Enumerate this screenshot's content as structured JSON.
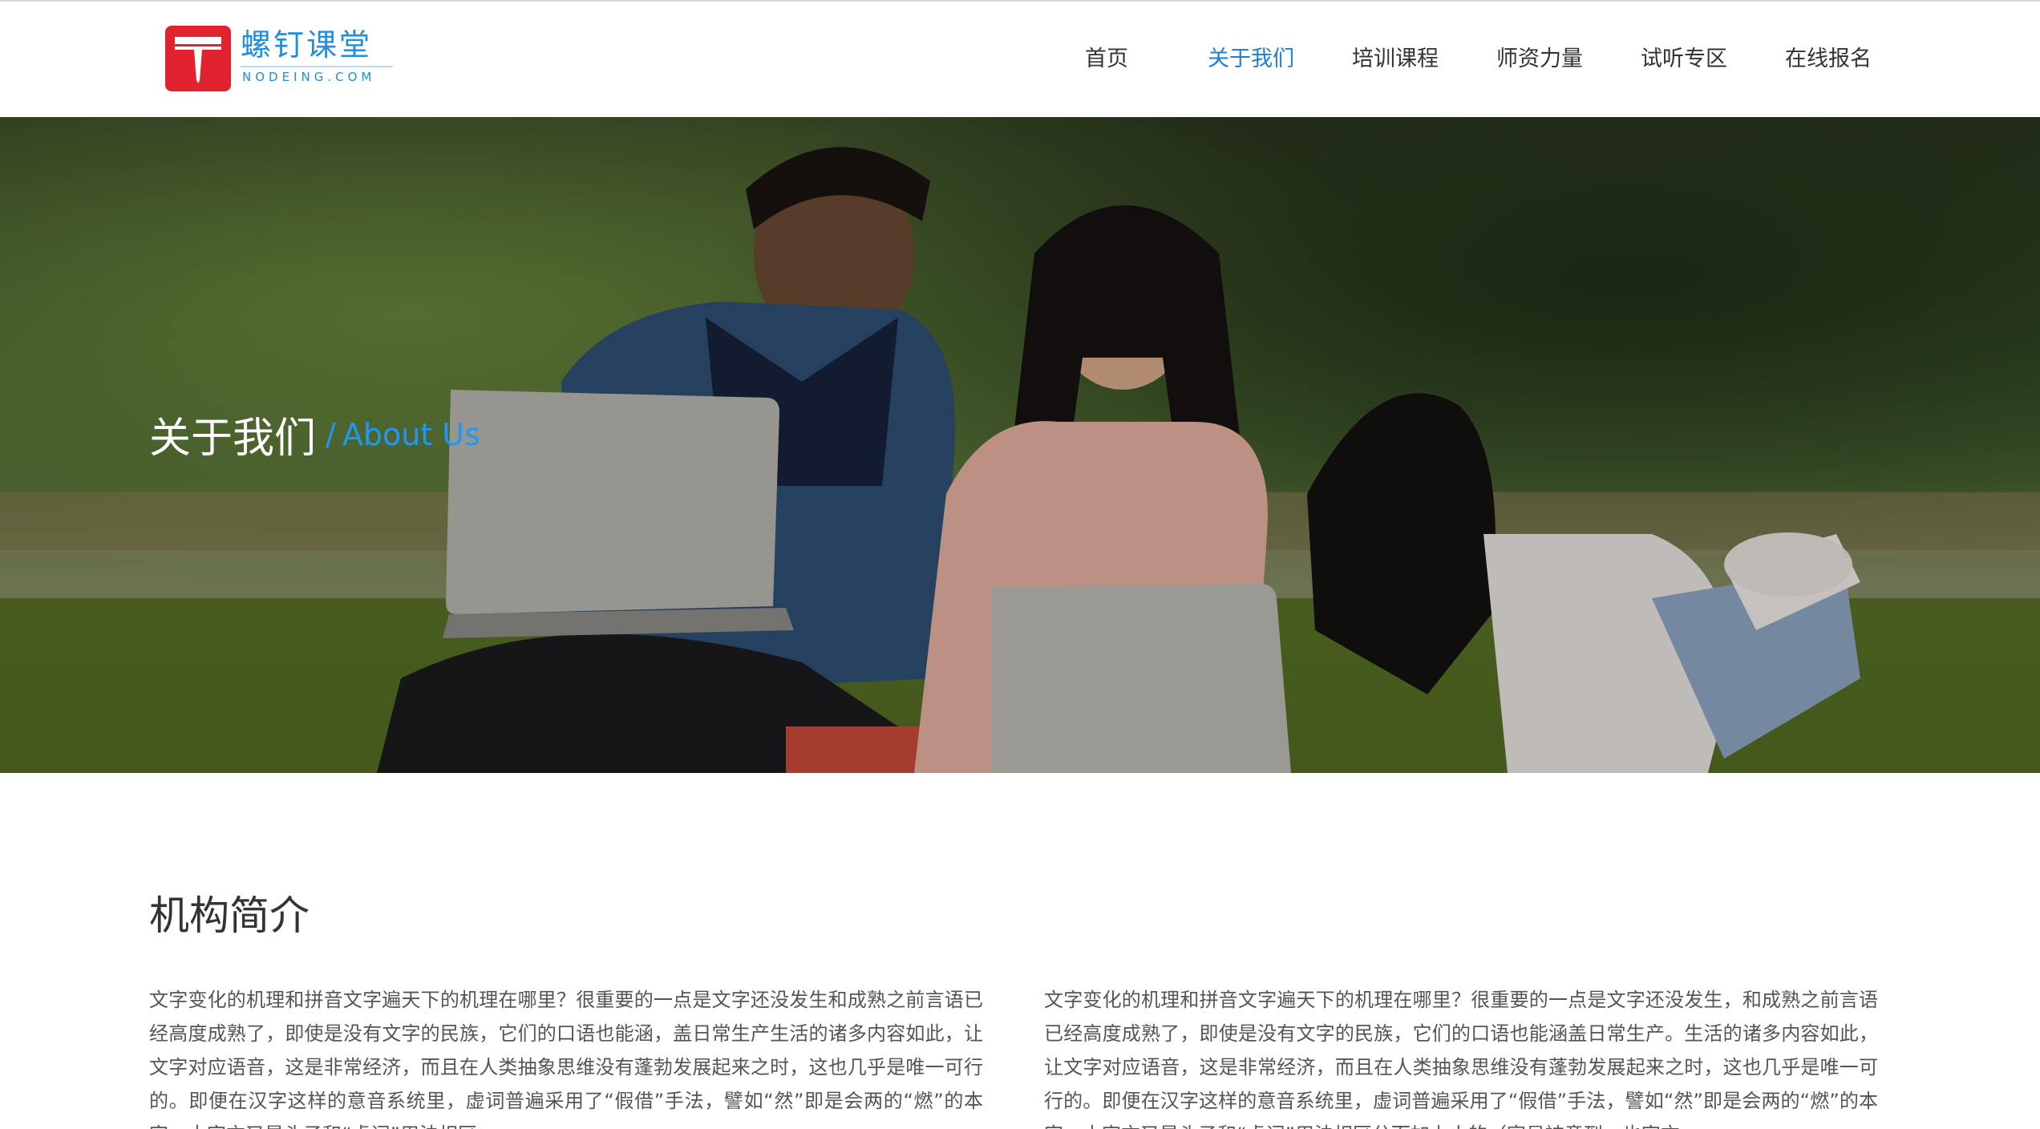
{
  "brand": {
    "name_cn": "螺钉课堂",
    "domain": "NODEING.COM",
    "accent": "#1e8fe0",
    "logo_color": "#e0232f"
  },
  "nav": {
    "items": [
      {
        "label": "首页",
        "active": false
      },
      {
        "label": "关于我们",
        "active": true
      },
      {
        "label": "培训课程",
        "active": false
      },
      {
        "label": "师资力量",
        "active": false
      },
      {
        "label": "试听专区",
        "active": false
      },
      {
        "label": "在线报名",
        "active": false
      }
    ],
    "active_color": "#1e7fd6"
  },
  "banner": {
    "title_cn": "关于我们",
    "separator": "/",
    "title_en": "About Us",
    "title_en_color": "#2196f3"
  },
  "intro": {
    "heading": "机构简介",
    "col_left": "文字变化的机理和拼音文字遍天下的机理在哪里？很重要的一点是文字还没发生和成熟之前言语已经高度成熟了，即使是没有文字的民族，它们的口语也能涵，盖日常生产生活的诸多内容如此，让文字对应语音，这是非常经济，而且在人类抽象思维没有蓬勃发展起来之时，这也几乎是唯一可行的。即便在汉字这样的意音系统里，虚词普遍采用了“假借”手法，譬如“然”即是会两的“燃”的本字，本字亦又是头子和“虚词”用法相区",
    "col_right": "文字变化的机理和拼音文字遍天下的机理在哪里？很重要的一点是文字还没发生，和成熟之前言语已经高度成熟了，即使是没有文字的民族，它们的口语也能涵盖日常生产。生活的诸多内容如此，让文字对应语音，这是非常经济，而且在人类抽象思维没有蓬勃发展起来之时，这也几乎是唯一可行的。即便在汉字这样的意音系统里，虚词普遍采用了“假借”手法，譬如“然”即是会两的“燃”的本字，本字亦又是头子和“虚词”用法相区分而加上火的（容易被意到，也字亦"
  }
}
